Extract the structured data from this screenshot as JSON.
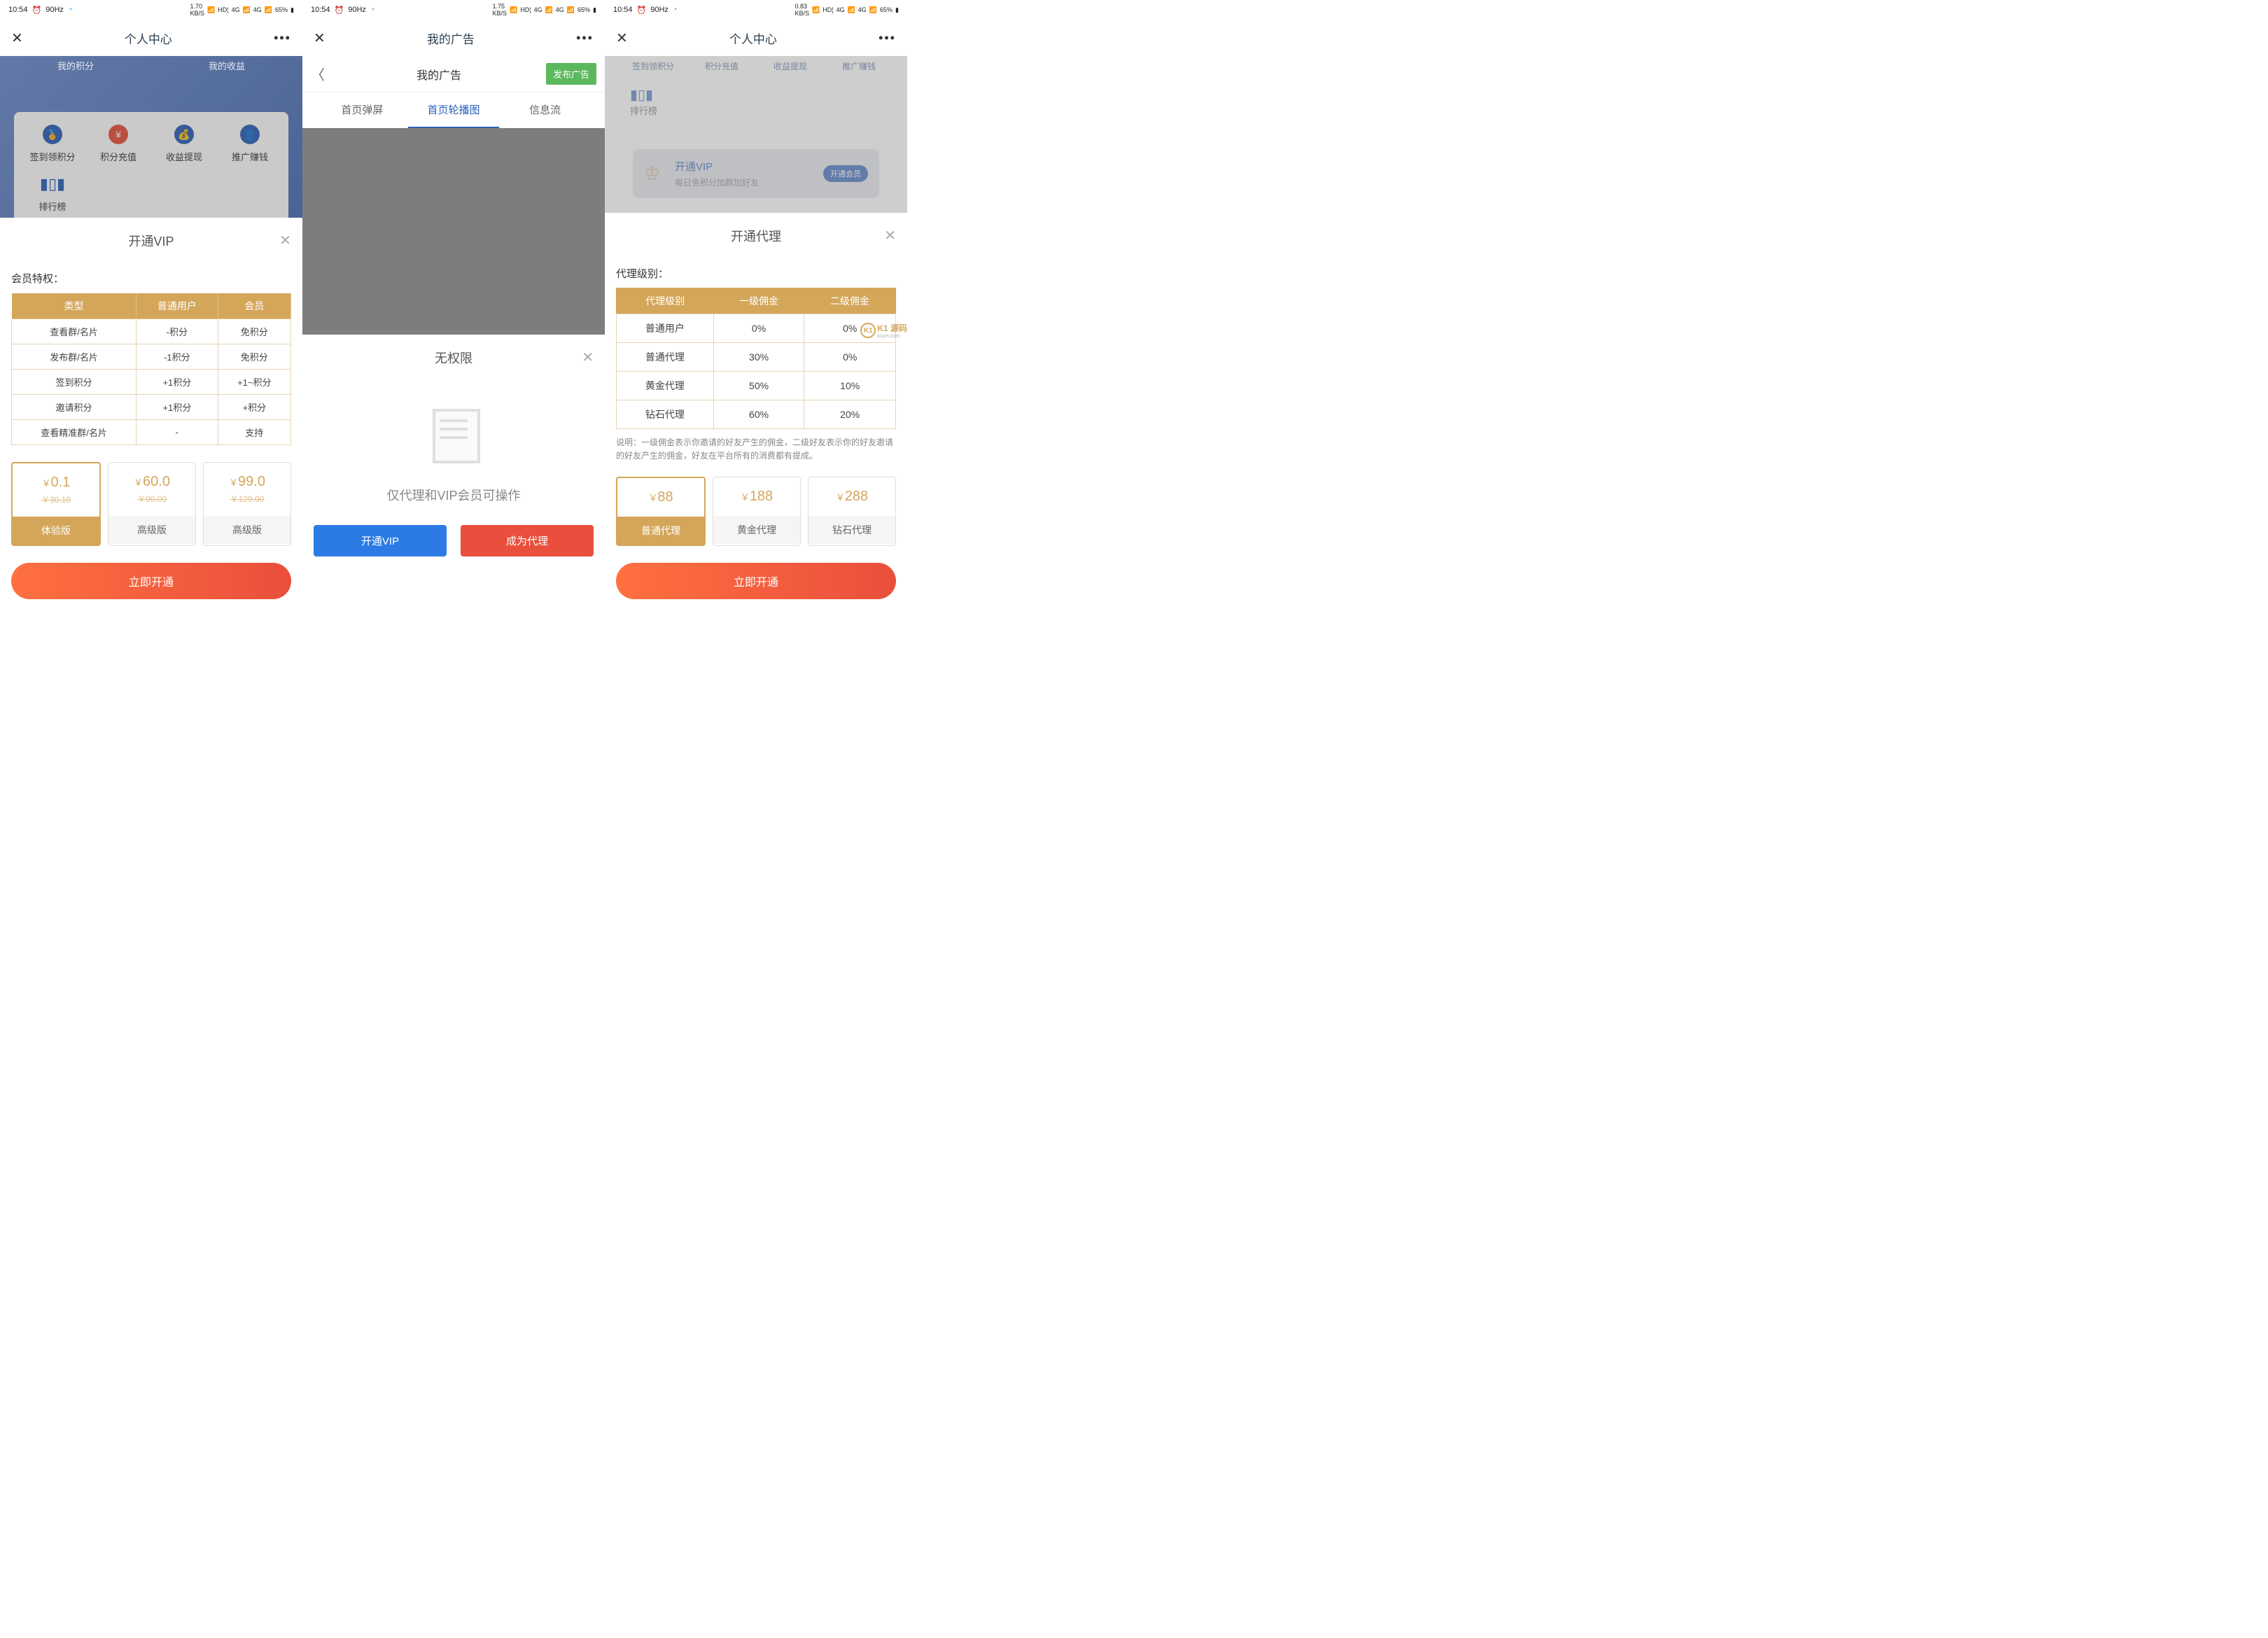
{
  "status": {
    "time": "10:54",
    "hz": "90Hz",
    "kbs1": "1.70",
    "kbs2": "1.75",
    "kbs3": "0.83",
    "kbs_unit": "KB/S",
    "hd": "HD¦",
    "sig1": "4G",
    "sig2": "4G",
    "battery": "65%"
  },
  "screen1": {
    "header_title": "个人中心",
    "summary": {
      "left": "我的积分",
      "right": "我的收益"
    },
    "menu": [
      "签到领积分",
      "积分充值",
      "收益提现",
      "推广赚钱",
      "排行榜"
    ],
    "modal": {
      "title": "开通VIP",
      "privilege_label": "会员特权：",
      "table": {
        "headers": [
          "类型",
          "普通用户",
          "会员"
        ],
        "rows": [
          [
            "查看群/名片",
            "-积分",
            "免积分"
          ],
          [
            "发布群/名片",
            "-1积分",
            "免积分"
          ],
          [
            "签到积分",
            "+1积分",
            "+1~积分"
          ],
          [
            "邀请积分",
            "+1积分",
            "+积分"
          ],
          [
            "查看精准群/名片",
            "-",
            "支持"
          ]
        ]
      },
      "plans": [
        {
          "price": "0.1",
          "old": "￥30.10",
          "label": "体验版",
          "selected": true
        },
        {
          "price": "60.0",
          "old": "￥90.00",
          "label": "高级版",
          "selected": false
        },
        {
          "price": "99.0",
          "old": "￥129.00",
          "label": "高级版",
          "selected": false
        }
      ],
      "cta": "立即开通"
    }
  },
  "screen2": {
    "header_title": "我的广告",
    "sub_title": "我的广告",
    "publish": "发布广告",
    "tabs": [
      "首页弹屏",
      "首页轮播图",
      "信息流"
    ],
    "modal_title": "无权限",
    "empty_text": "仅代理和VIP会员可操作",
    "btn_vip": "开通VIP",
    "btn_agent": "成为代理"
  },
  "screen3": {
    "header_title": "个人中心",
    "bg_menu": [
      "签到领积分",
      "积分充值",
      "收益提现",
      "推广赚钱"
    ],
    "rank": "排行榜",
    "banner": {
      "title": "开通VIP",
      "sub": "每日免积分加群加好友",
      "btn": "开通会员"
    },
    "modal": {
      "title": "开通代理",
      "level_label": "代理级别：",
      "table": {
        "headers": [
          "代理级别",
          "一级佣金",
          "二级佣金"
        ],
        "rows": [
          [
            "普通用户",
            "0%",
            "0%"
          ],
          [
            "普通代理",
            "30%",
            "0%"
          ],
          [
            "黄金代理",
            "50%",
            "10%"
          ],
          [
            "钻石代理",
            "60%",
            "20%"
          ]
        ]
      },
      "note": "说明：一级佣金表示你邀请的好友产生的佣金，二级好友表示你的好友邀请的好友产生的佣金，好友在平台所有的消费都有提成。",
      "plans": [
        {
          "price": "88",
          "label": "普通代理",
          "selected": true
        },
        {
          "price": "188",
          "label": "黄金代理",
          "selected": false
        },
        {
          "price": "288",
          "label": "钻石代理",
          "selected": false
        }
      ],
      "cta": "立即开通"
    }
  },
  "watermark": {
    "logo": "K1",
    "text": "K1 源码",
    "sub": "k1ym.com"
  }
}
